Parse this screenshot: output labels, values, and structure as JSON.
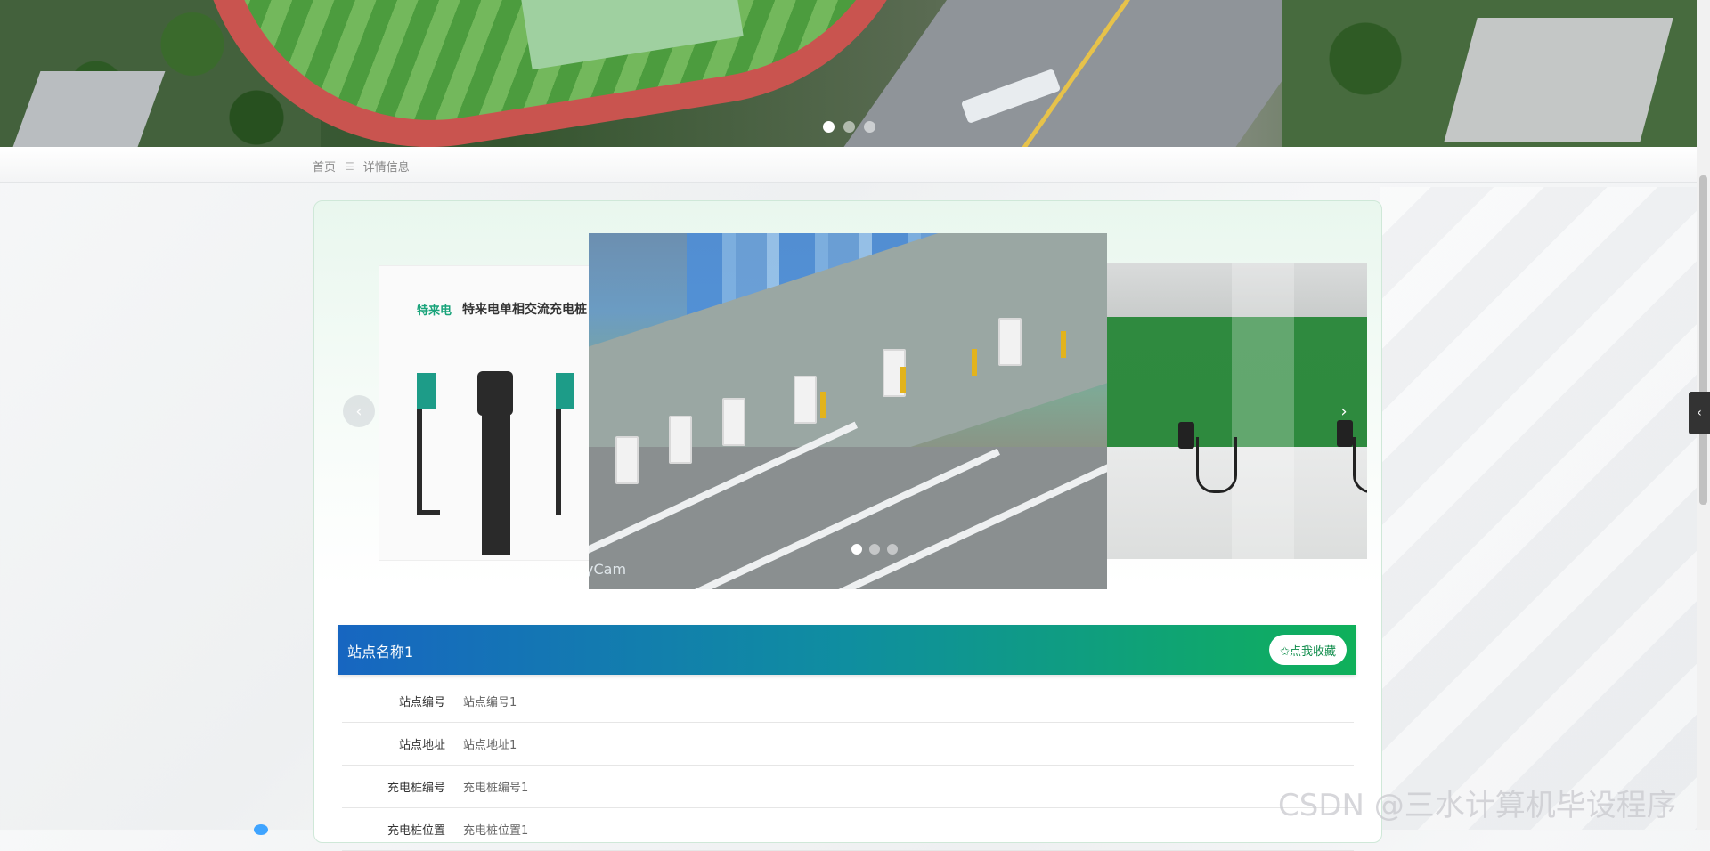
{
  "banner": {
    "dots": 3,
    "active_dot": 0
  },
  "breadcrumb": {
    "home": "首页",
    "separator": "☰",
    "current": "详情信息"
  },
  "carousel": {
    "left_slide_brand": "特来电单相交流充电桩",
    "left_slide_logo": "特来电",
    "main_slide_watermark": "yCam",
    "prev_icon": "‹",
    "next_icon": "›",
    "dots": 3,
    "active_dot": 0
  },
  "detail": {
    "title": "站点名称1",
    "favorite_label": "✩点我收藏",
    "rows": [
      {
        "label": "站点编号",
        "value": "站点编号1"
      },
      {
        "label": "站点地址",
        "value": "站点地址1"
      },
      {
        "label": "充电桩编号",
        "value": "充电桩编号1"
      },
      {
        "label": "充电桩位置",
        "value": "充电桩位置1"
      }
    ]
  },
  "side_tab_icon": "‹",
  "watermark": "CSDN @三水计算机毕设程序",
  "colors": {
    "accent_blue": "#1766c1",
    "accent_green": "#0fb05a"
  }
}
